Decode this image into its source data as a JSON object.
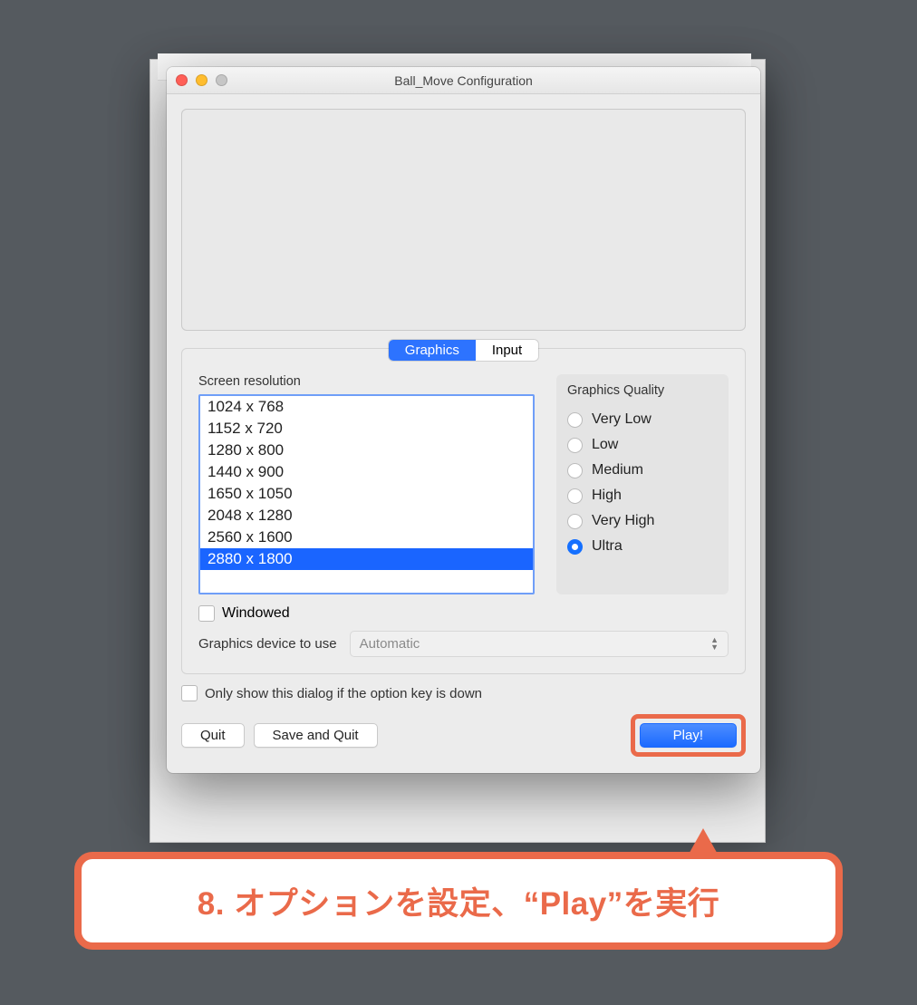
{
  "window": {
    "title": "Ball_Move Configuration"
  },
  "tabs": {
    "graphics": "Graphics",
    "input": "Input"
  },
  "labels": {
    "screen_resolution": "Screen resolution",
    "graphics_quality": "Graphics Quality",
    "windowed": "Windowed",
    "graphics_device": "Graphics device to use",
    "device_value": "Automatic",
    "only_show": "Only show this dialog if the option key is down"
  },
  "resolutions": [
    "1024 x 768",
    "1152 x 720",
    "1280 x 800",
    "1440 x 900",
    "1650 x 1050",
    "2048 x 1280",
    "2560 x 1600",
    "2880 x 1800"
  ],
  "selected_resolution_index": 7,
  "qualities": [
    "Very Low",
    "Low",
    "Medium",
    "High",
    "Very High",
    "Ultra"
  ],
  "selected_quality_index": 5,
  "buttons": {
    "quit": "Quit",
    "save_quit": "Save and Quit",
    "play": "Play!"
  },
  "callout": "8. オプションを設定、“Play”を実行"
}
